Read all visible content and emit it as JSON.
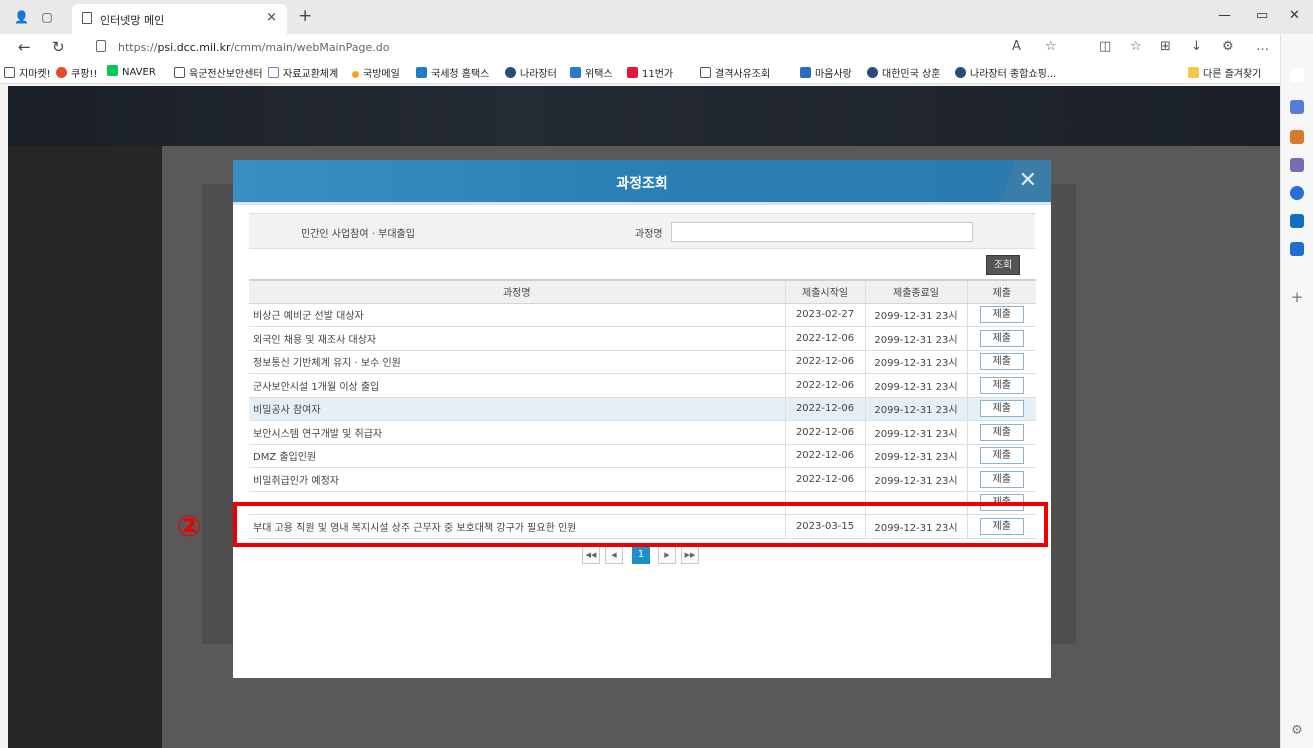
{
  "browser": {
    "tab_title": "인터넷망 메인",
    "url_prefix": "https://",
    "url_host": "psi.dcc.mil.kr",
    "url_path": "/cmm/main/webMainPage.do",
    "bookmarks": [
      {
        "label": "지마켓!",
        "color": "#ffffff"
      },
      {
        "label": "쿠팡!!",
        "color": "#e34b2a"
      },
      {
        "label": "NAVER",
        "color": "#03c75a"
      },
      {
        "label": "육군전산보안센터",
        "color": "#ffffff"
      },
      {
        "label": "자료교환체계",
        "color": "#6f7fc2"
      },
      {
        "label": "국방메일",
        "color": "#f3a521"
      },
      {
        "label": "국세청 홈택스",
        "color": "#1d7dc9"
      },
      {
        "label": "나라장터",
        "color": "#2b4b7c"
      },
      {
        "label": "위택스",
        "color": "#2b7ad1"
      },
      {
        "label": "11번가",
        "color": "#e3173e"
      },
      {
        "label": "결격사유조회",
        "color": "#ffffff"
      },
      {
        "label": "마음사랑",
        "color": "#2a6cbf"
      },
      {
        "label": "대한민국 상훈",
        "color": "#2b4b7c"
      },
      {
        "label": "나라장터 종합쇼핑...",
        "color": "#2b4b7c"
      }
    ],
    "other_favorites": "다른 즐겨찾기"
  },
  "modal": {
    "title": "과정조회",
    "category": "민간인 사업참여 · 부대출입",
    "course_name_label": "과정명",
    "course_name_value": "",
    "search_button": "조회",
    "columns": [
      "과정명",
      "제출시작일",
      "제출종료일",
      "제출"
    ],
    "rows": [
      {
        "name": "비상근 예비군 선발 대상자",
        "start": "2023-02-27",
        "end": "2099-12-31 23시",
        "action": "제출"
      },
      {
        "name": "외국인 채용 및 재조사 대상자",
        "start": "2022-12-06",
        "end": "2099-12-31 23시",
        "action": "제출"
      },
      {
        "name": "정보통신 기반체계 유지 · 보수 인원",
        "start": "2022-12-06",
        "end": "2099-12-31 23시",
        "action": "제출"
      },
      {
        "name": "군사보안시설 1개월 이상 출입",
        "start": "2022-12-06",
        "end": "2099-12-31 23시",
        "action": "제출"
      },
      {
        "name": "비밀공사 참여자",
        "start": "2022-12-06",
        "end": "2099-12-31 23시",
        "action": "제출"
      },
      {
        "name": "보안시스템 연구개발 및 취급자",
        "start": "2022-12-06",
        "end": "2099-12-31 23시",
        "action": "제출"
      },
      {
        "name": "DMZ 출입인원",
        "start": "2022-12-06",
        "end": "2099-12-31 23시",
        "action": "제출"
      },
      {
        "name": "비밀취급인가 예정자",
        "start": "2022-12-06",
        "end": "2099-12-31 23시",
        "action": "제출"
      },
      {
        "name": "",
        "start": "",
        "end": "",
        "action": "제출"
      },
      {
        "name": "부대 고용 직원 및 영내 복지시설 상주 근무자 중 보호대책 강구가 필요한 인원",
        "start": "2023-03-15",
        "end": "2099-12-31 23시",
        "action": "제출"
      }
    ],
    "pager": {
      "first": "◀◀",
      "prev": "◀",
      "current": "1",
      "next": "▶",
      "last": "▶▶"
    }
  },
  "annotation": {
    "marker": "②",
    "color": "#ee0000"
  }
}
